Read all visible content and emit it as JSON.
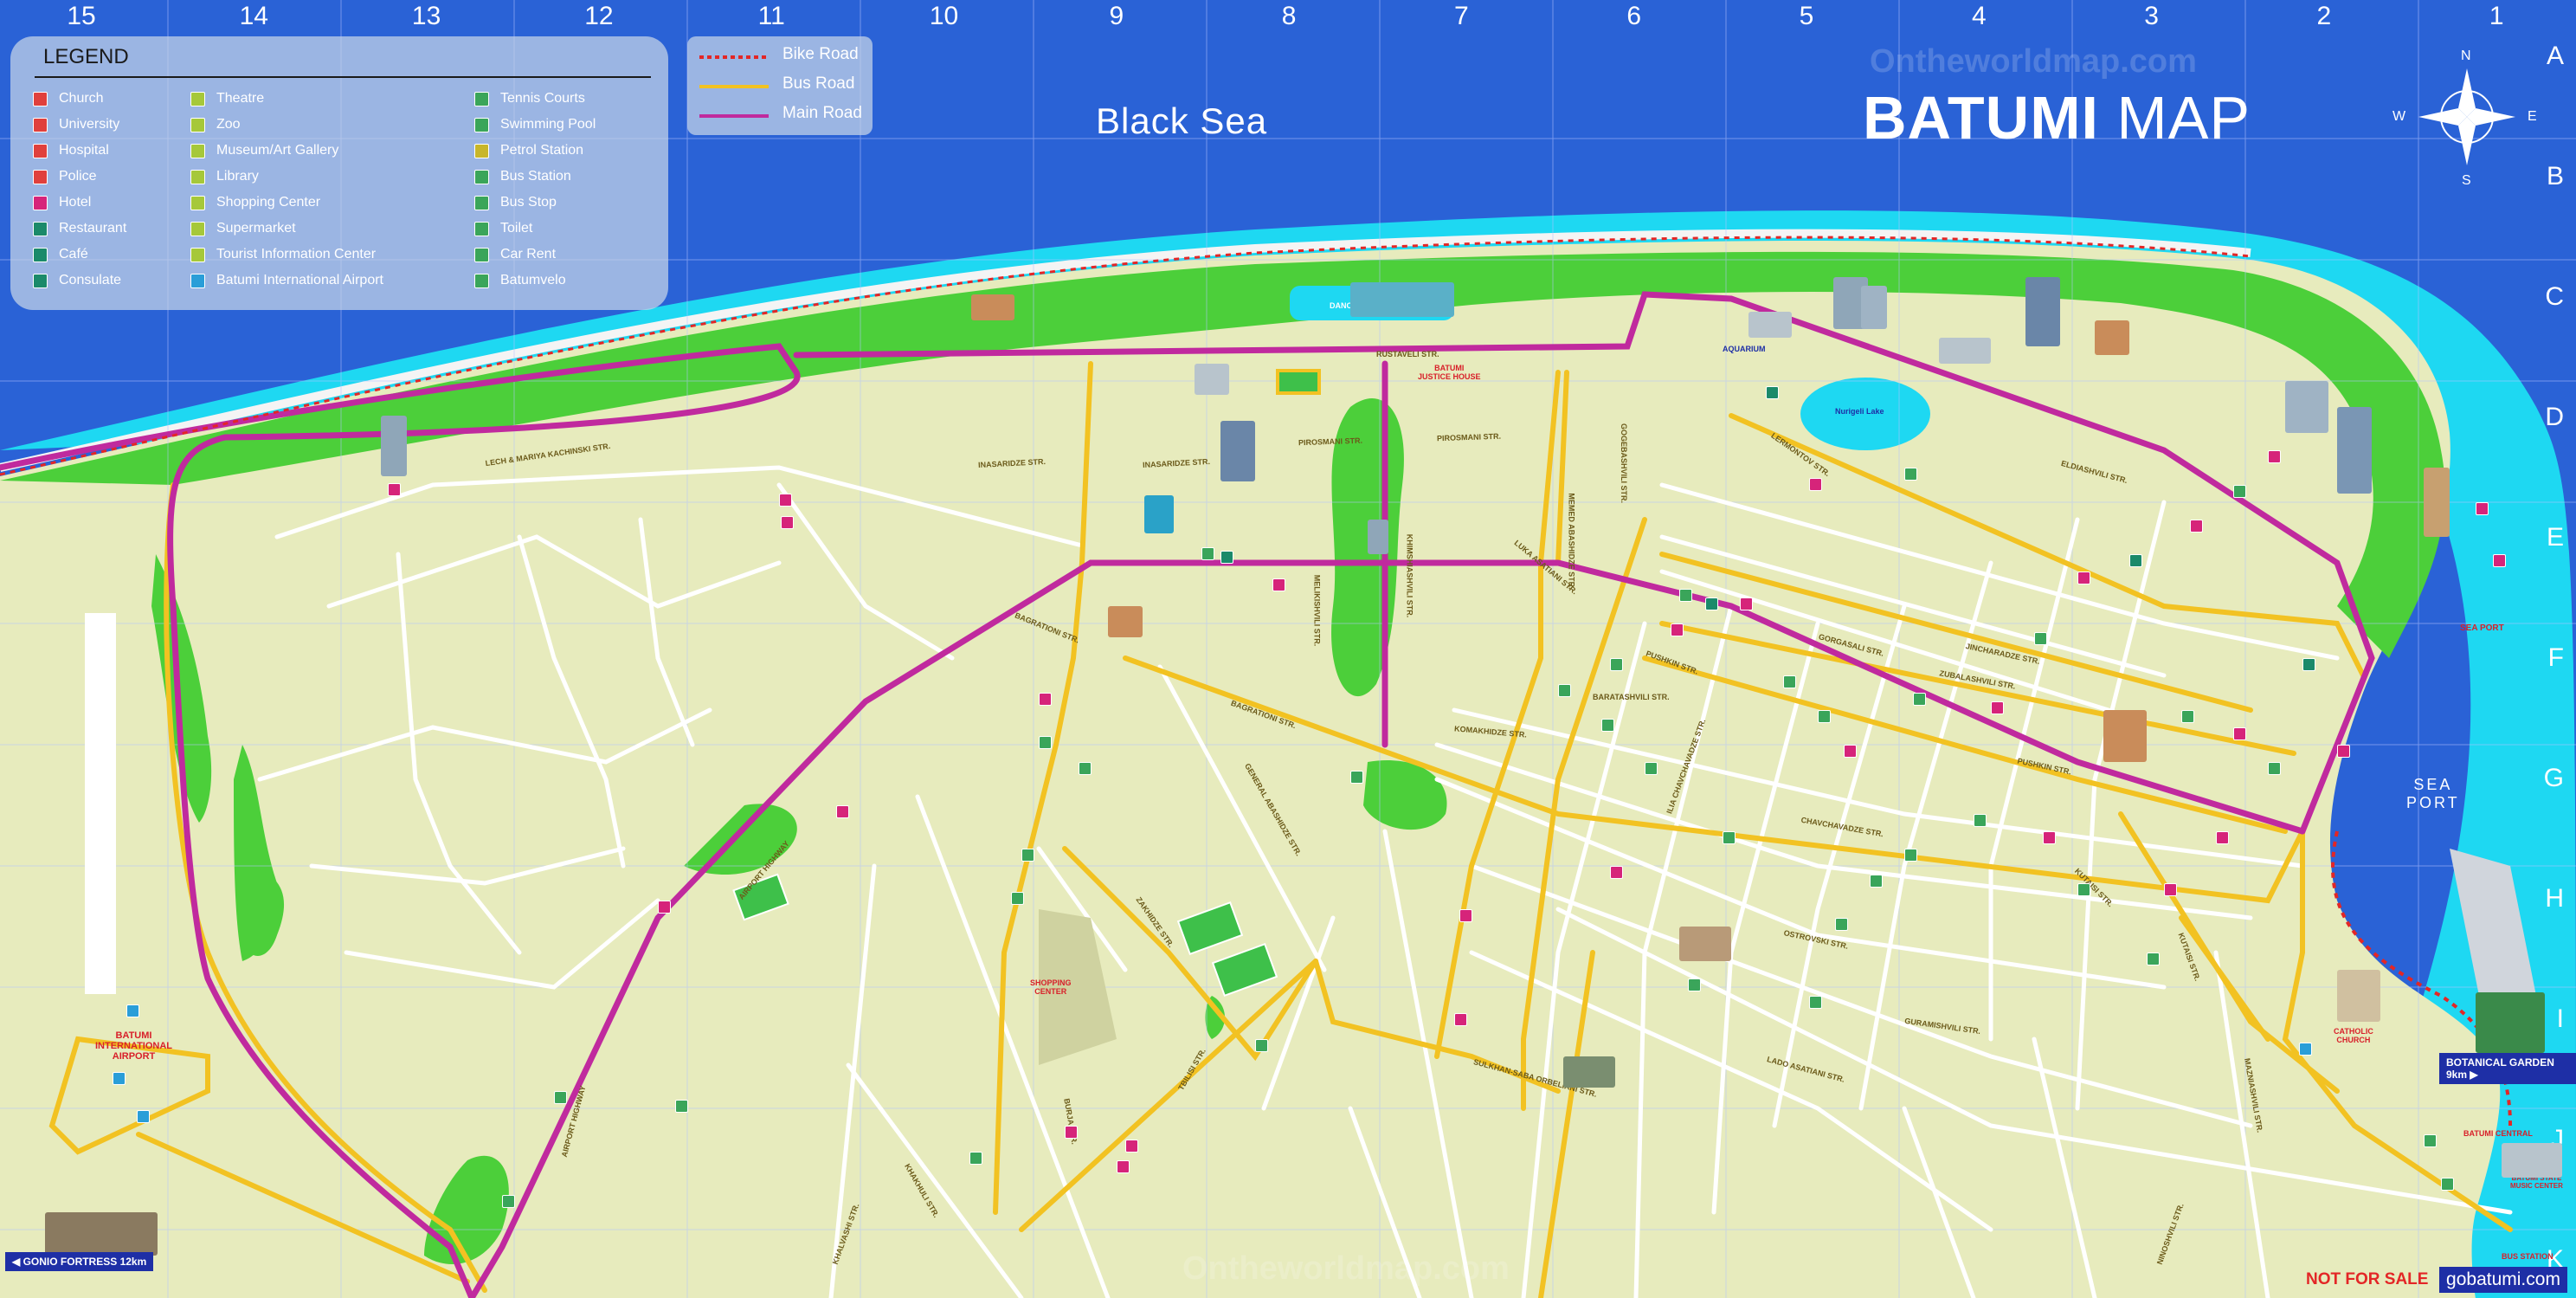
{
  "grid": {
    "columns": [
      "15",
      "14",
      "13",
      "12",
      "11",
      "10",
      "9",
      "8",
      "7",
      "6",
      "5",
      "4",
      "3",
      "2",
      "1"
    ],
    "rows": [
      "A",
      "B",
      "C",
      "D",
      "E",
      "F",
      "G",
      "H",
      "I",
      "J",
      "K"
    ]
  },
  "legend": {
    "title": "LEGEND",
    "col1": [
      {
        "label": "Church",
        "color": "#e0403c"
      },
      {
        "label": "University",
        "color": "#e0403c"
      },
      {
        "label": "Hospital",
        "color": "#e0403c"
      },
      {
        "label": "Police",
        "color": "#e0403c"
      },
      {
        "label": "Hotel",
        "color": "#d6247a"
      },
      {
        "label": "Restaurant",
        "color": "#1b8a6a"
      },
      {
        "label": "Café",
        "color": "#1b8a6a"
      },
      {
        "label": "Consulate",
        "color": "#1b8a6a"
      }
    ],
    "col2": [
      {
        "label": "Theatre",
        "color": "#a6c83a"
      },
      {
        "label": "Zoo",
        "color": "#a6c83a"
      },
      {
        "label": "Museum/Art Gallery",
        "color": "#a6c83a"
      },
      {
        "label": "Library",
        "color": "#a6c83a"
      },
      {
        "label": "Shopping Center",
        "color": "#a6c83a"
      },
      {
        "label": "Supermarket",
        "color": "#a6c83a"
      },
      {
        "label": "Tourist Information Center",
        "color": "#a6c83a"
      },
      {
        "label": "Batumi International Airport",
        "color": "#2a9ed8"
      }
    ],
    "col3": [
      {
        "label": "Tennis Courts",
        "color": "#3aa55a"
      },
      {
        "label": "Swimming Pool",
        "color": "#3aa55a"
      },
      {
        "label": "Petrol Station",
        "color": "#c8b62a"
      },
      {
        "label": "Bus Station",
        "color": "#3aa55a"
      },
      {
        "label": "Bus Stop",
        "color": "#3aa55a"
      },
      {
        "label": "Toilet",
        "color": "#3aa55a"
      },
      {
        "label": "Car Rent",
        "color": "#3aa55a"
      },
      {
        "label": "Batumvelo",
        "color": "#3aa55a"
      }
    ]
  },
  "routes": {
    "bike": "Bike Road",
    "bus": "Bus Road",
    "main": "Main Road",
    "colors": {
      "bike": "#e32626",
      "bus": "#f2c222",
      "main": "#c02a9e"
    }
  },
  "sea_label": "Black Sea",
  "title": {
    "bold": "BATUMI",
    "light": " MAP"
  },
  "compass": {
    "n": "N",
    "s": "S",
    "e": "E",
    "w": "W"
  },
  "streets": [
    "LECH & MARIYA KACHINSKI STR.",
    "INASARIDZE STR.",
    "INASARIDZE STR.",
    "PIROSMANI STR.",
    "PIROSMANI STR.",
    "RUSTAVELI STR.",
    "LUKA ASATIANI STR.",
    "MELIKISHVILI STR.",
    "BAGRATIONI STR.",
    "BAGRATIONI STR.",
    "AIRPORT HIGHWAY",
    "AIRPORT HIGHWAY",
    "KHIMSHIASHVILI STR.",
    "PUSHKIN STR.",
    "PUSHKIN STR.",
    "BARATASHVILI STR.",
    "KOMAKHIDZE STR.",
    "CHAVCHAVADZE STR.",
    "GORGASALI STR.",
    "ZUBALASHVILI STR.",
    "OSTROVSKI STR.",
    "GURAMISHVILI STR.",
    "LADO ASATIANI STR.",
    "SULKHAN-SABA ORBELIANI STR.",
    "GENERAL ABASHIDZE STR.",
    "KHALVASHI STR.",
    "KHAKHULI STR.",
    "BURJA STR.",
    "LERMONTOV STR.",
    "ZAKHIDZE STR.",
    "TBILISI STR.",
    "GOGEBASHVILI STR.",
    "MEMED ABASHIDZE STR.",
    "ILIA CHAVCHAVADZE STR.",
    "JINCHARADZE STR.",
    "KUTAISI STR.",
    "ELDIASHVILI STR.",
    "KUTAISI STR.",
    "MAZNIASHVILI STR.",
    "NINOSHVILI STR."
  ],
  "poi_labels": {
    "airport": "BATUMI\nINTERNATIONAL\nAIRPORT",
    "shopping": "SHOPPING\nCENTER",
    "aquarium": "AQUARIUM",
    "nurigeli": "Nurigeli Lake",
    "justice": "BATUMI\nJUSTICE HOUSE",
    "fountain": "DANCING FOUNTAIN",
    "seaport": "SEA\nPORT",
    "catholic": "CATHOLIC\nCHURCH",
    "batumi_central": "BATUMI CENTRAL",
    "music_center": "BATUMI STATE\nMUSIC CENTER",
    "bus_station": "BUS STATION",
    "sea_port_lab": "SEA PORT"
  },
  "badges": {
    "gonio": "◀ GONIO FORTRESS 12km",
    "botanical": "BOTANICAL GARDEN 9km ▶"
  },
  "watermarks": [
    "Ontheworldmap.com",
    "Ontheworldmap.com"
  ],
  "footer": {
    "not_for_sale": "NOT FOR SALE",
    "site": "gobatumi.com"
  }
}
